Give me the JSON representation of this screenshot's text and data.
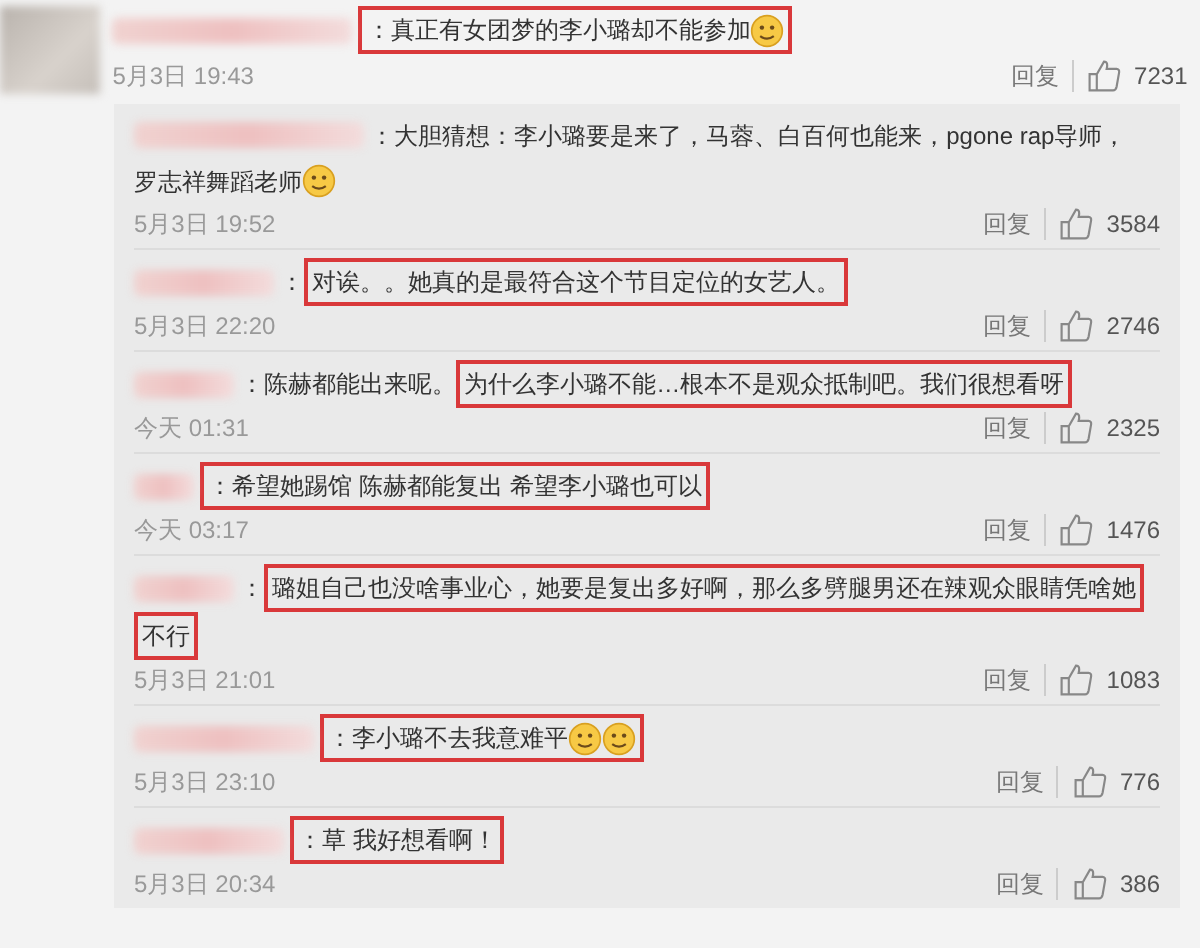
{
  "comment": {
    "lines": [
      [
        {
          "kind": "text",
          "text": "：真正有女团梦的李小璐却不能参加",
          "highlighted": true
        },
        {
          "kind": "emoji",
          "highlighted": true
        }
      ]
    ],
    "time": "5月3日 19:43",
    "reply": "回复",
    "likes": "7231"
  },
  "replies": [
    {
      "lines": [
        [
          {
            "kind": "text",
            "text": "：大胆猜想：李小璐要是来了，马蓉、白百何也能来，pgone rap导师，",
            "highlighted": false
          }
        ],
        [
          {
            "kind": "text",
            "text": "罗志祥舞蹈老师",
            "highlighted": false
          },
          {
            "kind": "emoji",
            "highlighted": false
          }
        ]
      ],
      "time": "5月3日 19:52",
      "reply": "回复",
      "likes": "3584"
    },
    {
      "lines": [
        [
          {
            "kind": "text",
            "text": "：",
            "highlighted": false
          },
          {
            "kind": "text",
            "text": "对诶。。她真的是最符合这个节目定位的女艺人。",
            "highlighted": true
          }
        ]
      ],
      "time": "5月3日 22:20",
      "reply": "回复",
      "likes": "2746"
    },
    {
      "lines": [
        [
          {
            "kind": "text",
            "text": "：陈赫都能出来呢。",
            "highlighted": false
          },
          {
            "kind": "text",
            "text": "为什么李小璐不能…根本不是观众抵制吧。我们很想看呀",
            "highlighted": true
          }
        ]
      ],
      "time": "今天 01:31",
      "reply": "回复",
      "likes": "2325"
    },
    {
      "lines": [
        [
          {
            "kind": "text",
            "text": "：希望她踢馆 陈赫都能复出 希望李小璐也可以",
            "highlighted": true
          }
        ]
      ],
      "time": "今天 03:17",
      "reply": "回复",
      "likes": "1476"
    },
    {
      "lines": [
        [
          {
            "kind": "text",
            "text": "：",
            "highlighted": false
          },
          {
            "kind": "text",
            "text": "璐姐自己也没啥事业心，她要是复出多好啊，那么多劈腿男还在辣观众眼睛凭啥她",
            "highlighted": true
          }
        ],
        [
          {
            "kind": "text",
            "text": "不行",
            "highlighted": true
          }
        ]
      ],
      "time": "5月3日 21:01",
      "reply": "回复",
      "likes": "1083"
    },
    {
      "lines": [
        [
          {
            "kind": "text",
            "text": "：李小璐不去我意难平",
            "highlighted": true
          },
          {
            "kind": "emoji",
            "highlighted": true
          },
          {
            "kind": "emoji",
            "highlighted": true
          }
        ]
      ],
      "time": "5月3日 23:10",
      "reply": "回复",
      "likes": "776"
    },
    {
      "lines": [
        [
          {
            "kind": "text",
            "text": "：草 我好想看啊！",
            "highlighted": true
          }
        ]
      ],
      "time": "5月3日 20:34",
      "reply": "回复",
      "likes": "386"
    }
  ]
}
